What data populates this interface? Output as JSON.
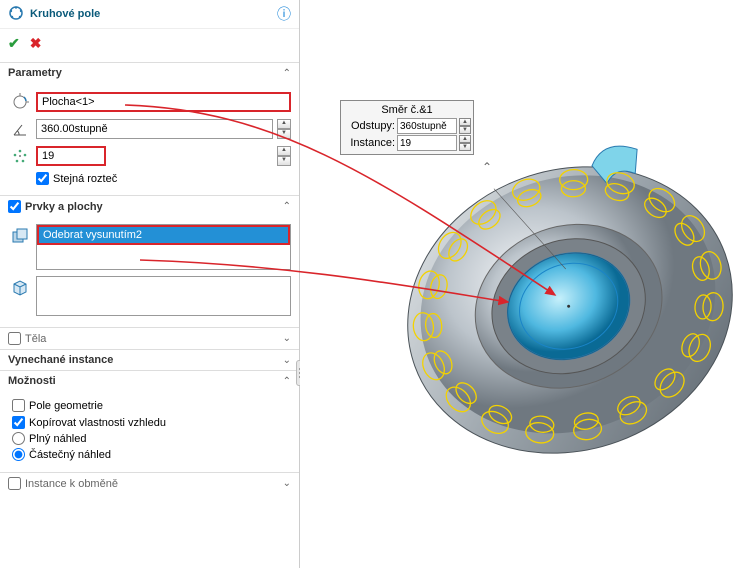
{
  "header": {
    "title": "Kruhové pole"
  },
  "sections": {
    "parametry": {
      "label": "Parametry",
      "axis_value": "Plocha<1>",
      "angle_value": "360.00stupně",
      "count_value": "19",
      "equal_spacing_label": "Stejná rozteč",
      "equal_spacing_checked": true
    },
    "prvky": {
      "label": "Prvky a plochy",
      "checked": true,
      "feature_item": "Odebrat vysunutím2"
    },
    "tela": {
      "label": "Těla",
      "checked": false
    },
    "vynechane": {
      "label": "Vynechané instance"
    },
    "moznosti": {
      "label": "Možnosti",
      "pole_geometrie_label": "Pole geometrie",
      "pole_geometrie_checked": false,
      "kopirovat_label": "Kopírovat vlastnosti vzhledu",
      "kopirovat_checked": true,
      "plny_label": "Plný náhled",
      "castecny_label": "Částečný náhled",
      "preview_selected": "castecny"
    },
    "instance_obmene": {
      "label": "Instance k obměně",
      "checked": false
    }
  },
  "callout": {
    "title": "Směr č.&1",
    "spacing_label": "Odstupy:",
    "spacing_value": "360stupně",
    "instances_label": "Instance:",
    "instances_value": "19"
  }
}
